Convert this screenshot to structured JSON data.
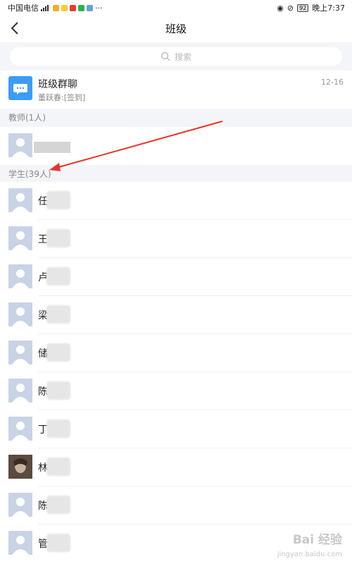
{
  "status_bar": {
    "carrier": "中国电信",
    "battery": "92",
    "time": "晚上7:37",
    "more": "···"
  },
  "navbar": {
    "back_icon": "chevron-left-icon",
    "title": "班级"
  },
  "search": {
    "placeholder": "搜索",
    "icon": "search-icon"
  },
  "group_chat": {
    "name": "班级群聊",
    "last_message": "董跃春:[签到]",
    "time": "12-16",
    "icon": "chat-bubble-icon",
    "accent_color": "#3b9cf7"
  },
  "teachers": {
    "header": "教师(1人)"
  },
  "students": {
    "header": "学生(39人)",
    "list": [
      {
        "name": "任",
        "avatar": "default"
      },
      {
        "name": "王",
        "avatar": "default"
      },
      {
        "name": "卢",
        "avatar": "default"
      },
      {
        "name": "梁",
        "avatar": "default"
      },
      {
        "name": "储",
        "avatar": "default"
      },
      {
        "name": "陈",
        "avatar": "default"
      },
      {
        "name": "丁",
        "avatar": "default"
      },
      {
        "name": "林",
        "avatar": "photo"
      },
      {
        "name": "陈",
        "avatar": "default"
      },
      {
        "name": "管",
        "avatar": "default"
      }
    ]
  },
  "annotation": {
    "color": "#e8352a"
  },
  "watermark": {
    "text": "Bai 经验",
    "sub": "jingyan.baidu.com"
  }
}
